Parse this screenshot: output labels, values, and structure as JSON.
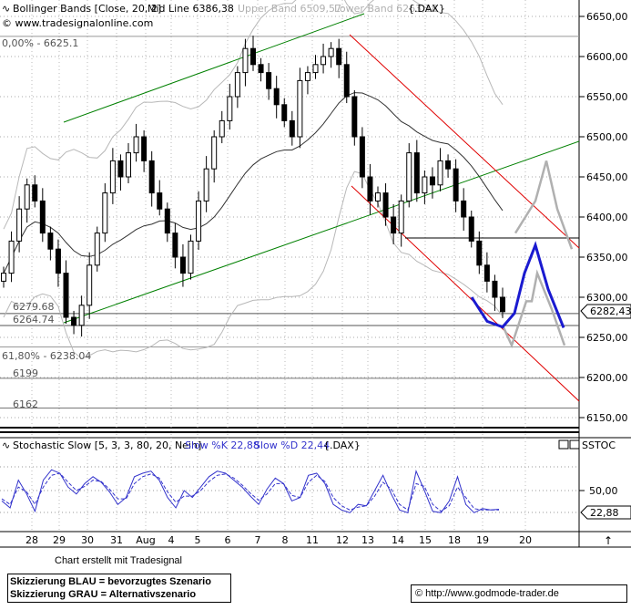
{
  "header": {
    "indicator": "Bollinger Bands [Close, 20, 2]",
    "mid_line": "Mid Line 6386,38",
    "upper_band": "Upper Band 6509,57",
    "lower_band": "Lower Band 6263,18",
    "symbol": "{.DAX}",
    "website": "© www.tradesignalonline.com"
  },
  "fib_labels": {
    "fib_0": "0,00% - 6625.1",
    "level_627968": "6279.68",
    "level_626474": "6264.74",
    "fib_618": "61,80% - 6238.04",
    "level_6199": "6199",
    "level_6162": "6162"
  },
  "price_axis": {
    "ticks": [
      "6650,00",
      "6600,00",
      "6550,00",
      "6500,00",
      "6450,00",
      "6400,00",
      "6350,00",
      "6300,00",
      "6250,00",
      "6200,00",
      "6150,00"
    ],
    "current_price": "6282,43"
  },
  "stoch": {
    "title": "Stochastic Slow [5, 3, 3, 80, 20, Nein]",
    "k_label": "Slow %K 22,88",
    "d_label": "Slow %D 22,44",
    "symbol": "{.DAX}",
    "tab_label": "SSTOC",
    "axis_ticks": [
      "50,00"
    ],
    "current_value": "22,88"
  },
  "x_axis": {
    "labels": [
      "28",
      "29",
      "30",
      "31",
      "Aug",
      "4",
      "5",
      "6",
      "7",
      "8",
      "11",
      "12",
      "13",
      "14",
      "15",
      "18",
      "19",
      "20"
    ]
  },
  "footer": {
    "created_by": "Chart erstellt mit Tradesignal",
    "legend_blue": "Skizzierung BLAU = bevorzugtes Szenario",
    "legend_grey": "Skizzierung GRAU = Alternativszenario",
    "source": "© http://www.godmode-trader.de"
  },
  "colors": {
    "candle": "#000000",
    "bollinger": "#b0b0b0",
    "midline": "#000000",
    "uptrend_channel": "#008000",
    "downtrend_channel": "#e00000",
    "scenario_blue": "#1a1ad0",
    "scenario_grey": "#b0b0b0",
    "stoch_k": "#3333cc",
    "stoch_d": "#3333cc"
  },
  "chart_data": {
    "type": "candlestick",
    "title": "Bollinger Bands [Close, 20, 2]",
    "price_ylim": [
      6140,
      6665
    ],
    "stoch_ylim": [
      0,
      100
    ],
    "x_categories": [
      "28",
      "29",
      "30",
      "31",
      "Aug",
      "4",
      "5",
      "6",
      "7",
      "8",
      "11",
      "12",
      "13",
      "14",
      "15",
      "18",
      "19",
      "20"
    ],
    "close_path": [
      6330,
      6370,
      6410,
      6440,
      6420,
      6380,
      6360,
      6330,
      6275,
      6265,
      6290,
      6340,
      6380,
      6430,
      6470,
      6450,
      6480,
      6500,
      6470,
      6430,
      6410,
      6380,
      6350,
      6330,
      6370,
      6420,
      6460,
      6500,
      6520,
      6550,
      6580,
      6610,
      6590,
      6580,
      6560,
      6540,
      6520,
      6500,
      6570,
      6580,
      6590,
      6600,
      6610,
      6590,
      6550,
      6500,
      6450,
      6420,
      6430,
      6400,
      6380,
      6420,
      6480,
      6430,
      6450,
      6440,
      6470,
      6460,
      6420,
      6400,
      6370,
      6340,
      6320,
      6300,
      6282
    ],
    "stoch_k_path": [
      35,
      25,
      65,
      45,
      20,
      65,
      80,
      75,
      55,
      45,
      60,
      70,
      62,
      48,
      30,
      40,
      70,
      75,
      78,
      65,
      40,
      25,
      50,
      40,
      55,
      70,
      78,
      75,
      65,
      55,
      42,
      30,
      52,
      68,
      60,
      35,
      40,
      72,
      75,
      60,
      30,
      22,
      18,
      30,
      28,
      50,
      72,
      45,
      22,
      18,
      78,
      50,
      20,
      18,
      35,
      70,
      30,
      18,
      24,
      22,
      23
    ],
    "stoch_d_path": [
      38,
      30,
      55,
      48,
      30,
      55,
      72,
      75,
      62,
      50,
      56,
      65,
      63,
      52,
      38,
      38,
      60,
      70,
      74,
      68,
      48,
      33,
      42,
      42,
      50,
      63,
      72,
      74,
      68,
      58,
      46,
      36,
      45,
      60,
      60,
      43,
      40,
      62,
      72,
      63,
      40,
      28,
      22,
      26,
      28,
      42,
      62,
      52,
      30,
      22,
      60,
      56,
      30,
      20,
      28,
      55,
      40,
      24,
      22,
      22,
      22
    ],
    "levels": [
      {
        "label": "0,00% - 6625.1",
        "value": 6625.1
      },
      {
        "label": "6279.68",
        "value": 6279.68
      },
      {
        "label": "6264.74",
        "value": 6264.74
      },
      {
        "label": "61,80% - 6238.04",
        "value": 6238.04
      },
      {
        "label": "6199",
        "value": 6199
      },
      {
        "label": "6162",
        "value": 6162
      }
    ],
    "horizontal_resistance": 6372,
    "scenario_blue": [
      6300,
      6270,
      6263,
      6280,
      6330,
      6365,
      6310,
      6262
    ],
    "scenario_grey": [
      6265,
      6240,
      6295,
      6250,
      6240,
      6380,
      6380,
      6420,
      6470,
      6410,
      6360
    ]
  }
}
